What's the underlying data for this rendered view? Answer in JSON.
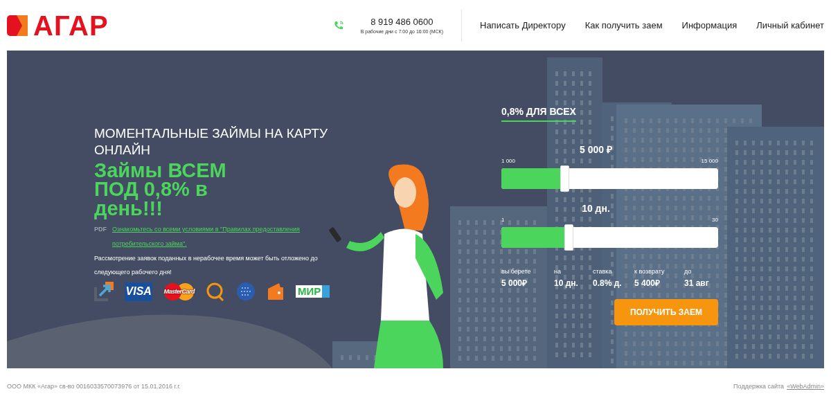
{
  "header": {
    "logo": "АГАР",
    "phone": "8 919 486 0600",
    "hours": "В рабочие дни с 7:00 до 16:00 (МСК)",
    "nav": [
      {
        "label": "Написать Директору"
      },
      {
        "label": "Как получить заем"
      },
      {
        "label": "Информация"
      },
      {
        "label": "Личный кабинет"
      }
    ]
  },
  "hero": {
    "subtitle": "МОМЕНТАЛЬНЫЕ ЗАЙМЫ НА КАРТУ ОНЛАЙН",
    "headline": "Займы ВСЕМ ПОД 0,8% в день!!!",
    "pdf_label": "PDF",
    "pdf_link": "Ознакомьтесь со всеми условиями в \"Правилах предоставления потребительского займа\".",
    "notice": "Рассмотрение заявок поданных в нерабочее время может быть отложено до следующего рабочего дня!",
    "payment_methods": [
      {
        "kind": "arrow"
      },
      {
        "kind": "visa",
        "text": "VISA"
      },
      {
        "kind": "mastercard",
        "text": "MasterCard"
      },
      {
        "kind": "qiwi"
      },
      {
        "kind": "webmoney"
      },
      {
        "kind": "wallet"
      },
      {
        "kind": "mir",
        "text": "МИР"
      }
    ]
  },
  "calculator": {
    "title": "0,8% ДЛЯ ВСЕХ",
    "sliders": [
      {
        "value": "5 000 ₽",
        "min": "1 000",
        "max": "15 000",
        "level": 0.29
      },
      {
        "value": "10 дн.",
        "min": "1",
        "max": "30",
        "level": 0.31
      }
    ],
    "summary": [
      {
        "label": "вы берете",
        "value": "5 000₽"
      },
      {
        "label": "на",
        "value": "10 дн."
      },
      {
        "label": "ставка",
        "value": "0.8% д."
      },
      {
        "label": "к возврату",
        "value": "5 400₽"
      },
      {
        "label": "до",
        "value": "31 авг"
      }
    ],
    "button": "ПОЛУЧИТЬ ЗАЕМ"
  },
  "footer": {
    "company": "ООО МКК «Агар» св-во 0016033570073976 от 15.01.2016 г.г.",
    "support_label": "Поддержка сайта",
    "support_link": "«WebAdmin»"
  }
}
